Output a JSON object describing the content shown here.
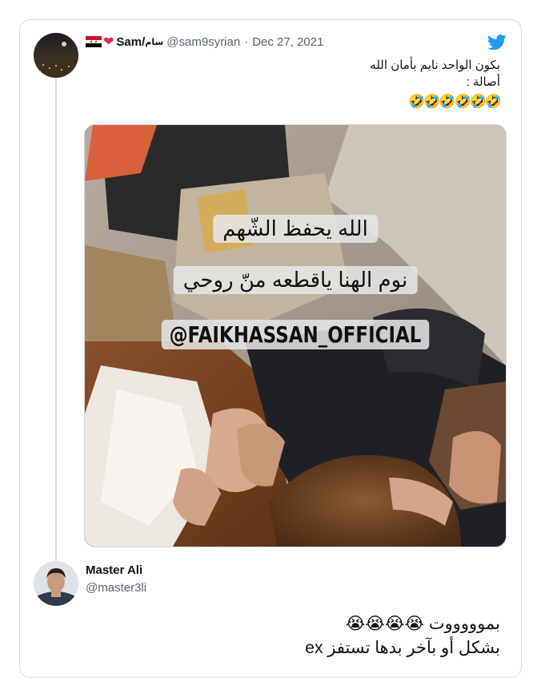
{
  "tweet": {
    "display_name": "Sam/",
    "display_name_ar": "سام",
    "handle": "@sam9syrian",
    "separator": "·",
    "date": "Dec 27, 2021",
    "line1": "بكون الواحد نايم بأمان الله",
    "line2": "أصالة :",
    "emoji_line": "🤣🤣🤣🤣🤣🤣",
    "media_overlay": {
      "line1": "الله يحفظ الشّهم",
      "line2": "نوم الهنا ياقطعه منّ روحي",
      "line3": "@FAIKHASSAN_OFFICIAL"
    }
  },
  "reply": {
    "display_name": "Master Ali",
    "handle": "@master3li",
    "line1": "بموووووت 😭😭😭😭",
    "line2": "بشكل أو بآخر بدها تستفز ex"
  },
  "colors": {
    "twitter_blue": "#1d9bf0",
    "heart": "#e0245e",
    "secondary_text": "#536471",
    "border": "#cfd9de"
  },
  "icons": [
    "syria-flag-icon",
    "heart-icon",
    "twitter-bird-icon"
  ]
}
